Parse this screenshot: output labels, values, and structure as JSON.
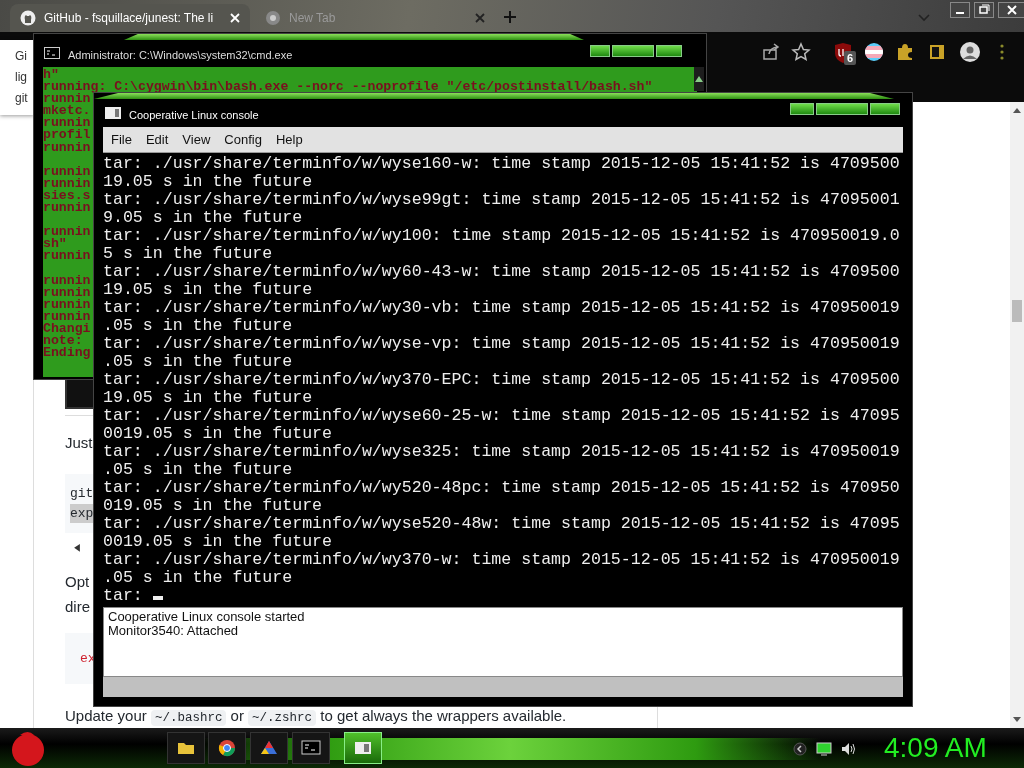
{
  "browser": {
    "tabs": [
      {
        "title": "GitHub - fsquillace/junest: The li",
        "selected": true
      },
      {
        "title": "New Tab",
        "selected": false
      }
    ],
    "extension_badge": "6",
    "popup_lines": [
      "Gi",
      "lig",
      "git"
    ],
    "page": {
      "intro": "Just",
      "code_lines": [
        {
          "text": "git",
          "highlighted": false
        },
        {
          "text": "exp",
          "highlighted": true
        }
      ],
      "option_lines": [
        "Opt",
        "dire"
      ],
      "code_snippet": "ex",
      "footer_sentence": [
        {
          "kind": "text",
          "text": "Update your "
        },
        {
          "kind": "code",
          "text": "~/.bashrc"
        },
        {
          "kind": "text",
          "text": " or "
        },
        {
          "kind": "code",
          "text": "~/.zshrc"
        },
        {
          "kind": "text",
          "text": " to get always the wrappers available."
        }
      ]
    }
  },
  "cmd_window": {
    "title": "Administrator: C:\\Windows\\system32\\cmd.exe",
    "paragraphs": [
      [
        "h\"",
        "running: C:\\cygwin\\bin\\bash.exe --norc --noprofile \"/etc/postinstall/bash.sh\"",
        "runnin",
        "mketc.",
        "runnin",
        "profil",
        "runnin"
      ],
      [
        "runnin",
        "runnin",
        "sies.s",
        "runnin"
      ],
      [
        "runnin",
        "sh\"",
        "runnin"
      ],
      [
        "runnin",
        "runnin",
        "runnin",
        "runnin",
        "Changi",
        "note:",
        "Ending"
      ]
    ]
  },
  "console_window": {
    "title": "Cooperative Linux console",
    "menu": [
      "File",
      "Edit",
      "View",
      "Config",
      "Help"
    ],
    "terminal_lines": [
      "tar: ./usr/share/terminfo/w/wyse160-w: time stamp 2015-12-05 15:41:52 is 4709500",
      "19.05 s in the future",
      "tar: ./usr/share/terminfo/w/wyse99gt: time stamp 2015-12-05 15:41:52 is 47095001",
      "9.05 s in the future",
      "tar: ./usr/share/terminfo/w/wy100: time stamp 2015-12-05 15:41:52 is 470950019.0",
      "5 s in the future",
      "tar: ./usr/share/terminfo/w/wy60-43-w: time stamp 2015-12-05 15:41:52 is 4709500",
      "19.05 s in the future",
      "tar: ./usr/share/terminfo/w/wy30-vb: time stamp 2015-12-05 15:41:52 is 470950019",
      ".05 s in the future",
      "tar: ./usr/share/terminfo/w/wyse-vp: time stamp 2015-12-05 15:41:52 is 470950019",
      ".05 s in the future",
      "tar: ./usr/share/terminfo/w/wy370-EPC: time stamp 2015-12-05 15:41:52 is 4709500",
      "19.05 s in the future",
      "tar: ./usr/share/terminfo/w/wyse60-25-w: time stamp 2015-12-05 15:41:52 is 47095",
      "0019.05 s in the future",
      "tar: ./usr/share/terminfo/w/wyse325: time stamp 2015-12-05 15:41:52 is 470950019",
      ".05 s in the future",
      "tar: ./usr/share/terminfo/w/wy520-48pc: time stamp 2015-12-05 15:41:52 is 470950",
      "019.05 s in the future",
      "tar: ./usr/share/terminfo/w/wyse520-48w: time stamp 2015-12-05 15:41:52 is 47095",
      "0019.05 s in the future",
      "tar: ./usr/share/terminfo/w/wy370-w: time stamp 2015-12-05 15:41:52 is 470950019",
      ".05 s in the future",
      "tar:"
    ],
    "cursor": true,
    "log_lines": [
      "Cooperative Linux console started",
      "Monitor3540: Attached"
    ]
  },
  "taskbar": {
    "items": [
      {
        "kind": "folder",
        "active": false
      },
      {
        "kind": "browser",
        "active": false
      },
      {
        "kind": "paint",
        "active": false
      },
      {
        "kind": "terminal",
        "active": false
      },
      {
        "kind": "console",
        "active": true
      }
    ],
    "clock": "4:09 AM"
  }
}
